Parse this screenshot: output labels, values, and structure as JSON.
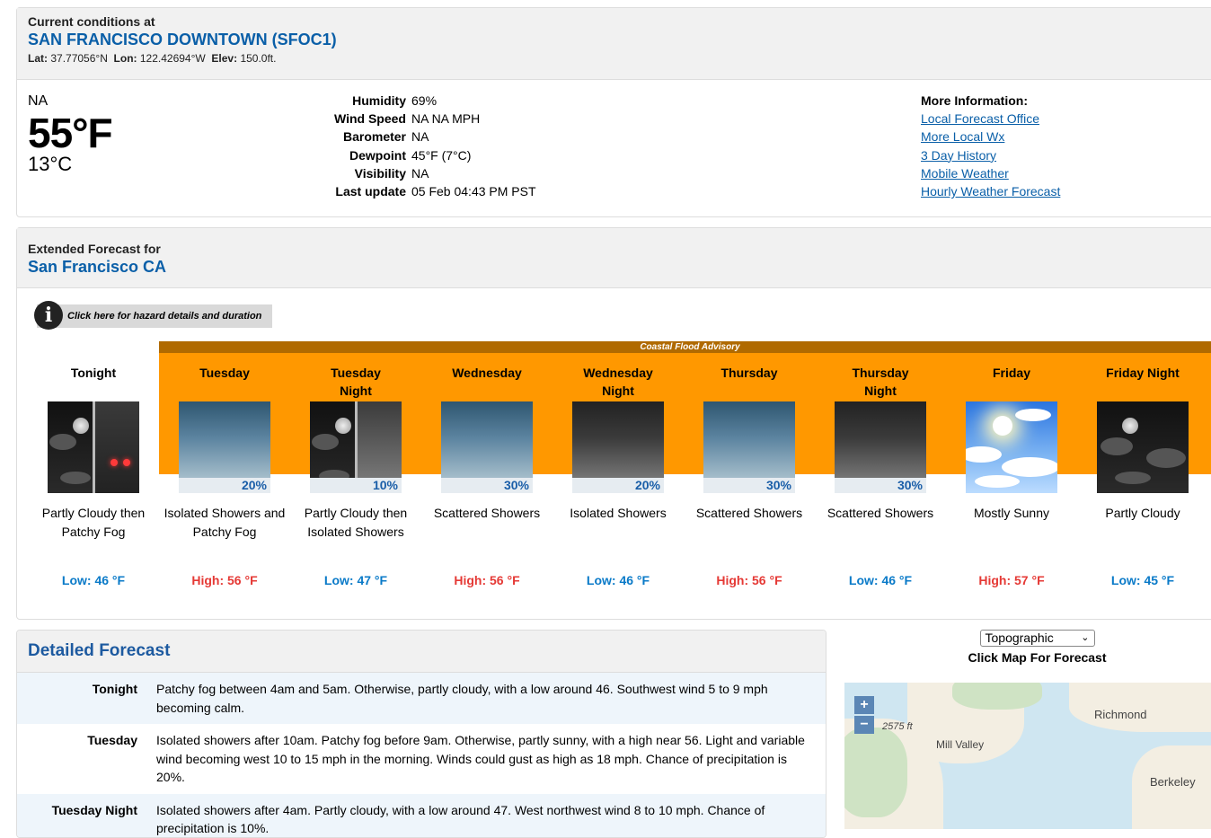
{
  "current": {
    "heading": "Current conditions at",
    "station": "SAN FRANCISCO DOWNTOWN (SFOC1)",
    "lat_label": "Lat:",
    "lat": "37.77056°N",
    "lon_label": "Lon:",
    "lon": "122.42694°W",
    "elev_label": "Elev:",
    "elev": "150.0ft.",
    "condition": "NA",
    "temp_f": "55°F",
    "temp_c": "13°C",
    "details": [
      {
        "k": "Humidity",
        "v": "69%"
      },
      {
        "k": "Wind Speed",
        "v": "NA NA MPH"
      },
      {
        "k": "Barometer",
        "v": "NA"
      },
      {
        "k": "Dewpoint",
        "v": "45°F (7°C)"
      },
      {
        "k": "Visibility",
        "v": "NA"
      },
      {
        "k": "Last update",
        "v": "05 Feb 04:43 PM PST"
      }
    ],
    "more_heading": "More Information:",
    "links": [
      "Local Forecast Office",
      "More Local Wx",
      "3 Day History",
      "Mobile Weather",
      "Hourly Weather Forecast"
    ]
  },
  "extended": {
    "heading": "Extended Forecast for",
    "location": "San Francisco CA",
    "hazard_text": "Click here for hazard details and duration",
    "advisory": "Coastal Flood Advisory",
    "periods": [
      {
        "name": "Tonight",
        "desc": "Partly Cloudy then Patchy Fog",
        "temp": "Low: 46 °F",
        "pop": "",
        "icon": "night-partly-cloudy-fog-icon"
      },
      {
        "name": "Tuesday",
        "desc": "Isolated Showers and Patchy Fog",
        "temp": "High: 56 °F",
        "pop": "20%",
        "icon": "showers-icon"
      },
      {
        "name": "Tuesday Night",
        "desc": "Partly Cloudy then Isolated Showers",
        "temp": "Low: 47 °F",
        "pop": "10%",
        "icon": "night-cloudy-showers-icon"
      },
      {
        "name": "Wednesday",
        "desc": "Scattered Showers",
        "temp": "High: 56 °F",
        "pop": "30%",
        "icon": "showers-icon"
      },
      {
        "name": "Wednesday Night",
        "desc": "Isolated Showers",
        "temp": "Low: 46 °F",
        "pop": "20%",
        "icon": "night-showers-icon"
      },
      {
        "name": "Thursday",
        "desc": "Scattered Showers",
        "temp": "High: 56 °F",
        "pop": "30%",
        "icon": "showers-icon"
      },
      {
        "name": "Thursday Night",
        "desc": "Scattered Showers",
        "temp": "Low: 46 °F",
        "pop": "30%",
        "icon": "night-showers-icon"
      },
      {
        "name": "Friday",
        "desc": "Mostly Sunny",
        "temp": "High: 57 °F",
        "pop": "",
        "icon": "mostly-sunny-icon"
      },
      {
        "name": "Friday Night",
        "desc": "Partly Cloudy",
        "temp": "Low: 45 °F",
        "pop": "",
        "icon": "night-partly-cloudy-icon"
      }
    ]
  },
  "detailed": {
    "heading": "Detailed Forecast",
    "rows": [
      {
        "k": "Tonight",
        "v": "Patchy fog between 4am and 5am. Otherwise, partly cloudy, with a low around 46. Southwest wind 5 to 9 mph becoming calm."
      },
      {
        "k": "Tuesday",
        "v": "Isolated showers after 10am. Patchy fog before 9am. Otherwise, partly sunny, with a high near 56. Light and variable wind becoming west 10 to 15 mph in the morning. Winds could gust as high as 18 mph. Chance of precipitation is 20%."
      },
      {
        "k": "Tuesday Night",
        "v": "Isolated showers after 4am. Partly cloudy, with a low around 47. West northwest wind 8 to 10 mph. Chance of precipitation is 10%."
      }
    ]
  },
  "map": {
    "select_value": "Topographic",
    "hint": "Click Map For Forecast",
    "zoom_in": "+",
    "zoom_out": "−",
    "labels": [
      "Richmond",
      "Mill Valley",
      "Berkeley",
      "2575 ft"
    ]
  },
  "colors": {
    "link": "#0a5fa8",
    "advisory": "#ff9800",
    "low": "#0a7ac8",
    "high": "#e53935"
  }
}
